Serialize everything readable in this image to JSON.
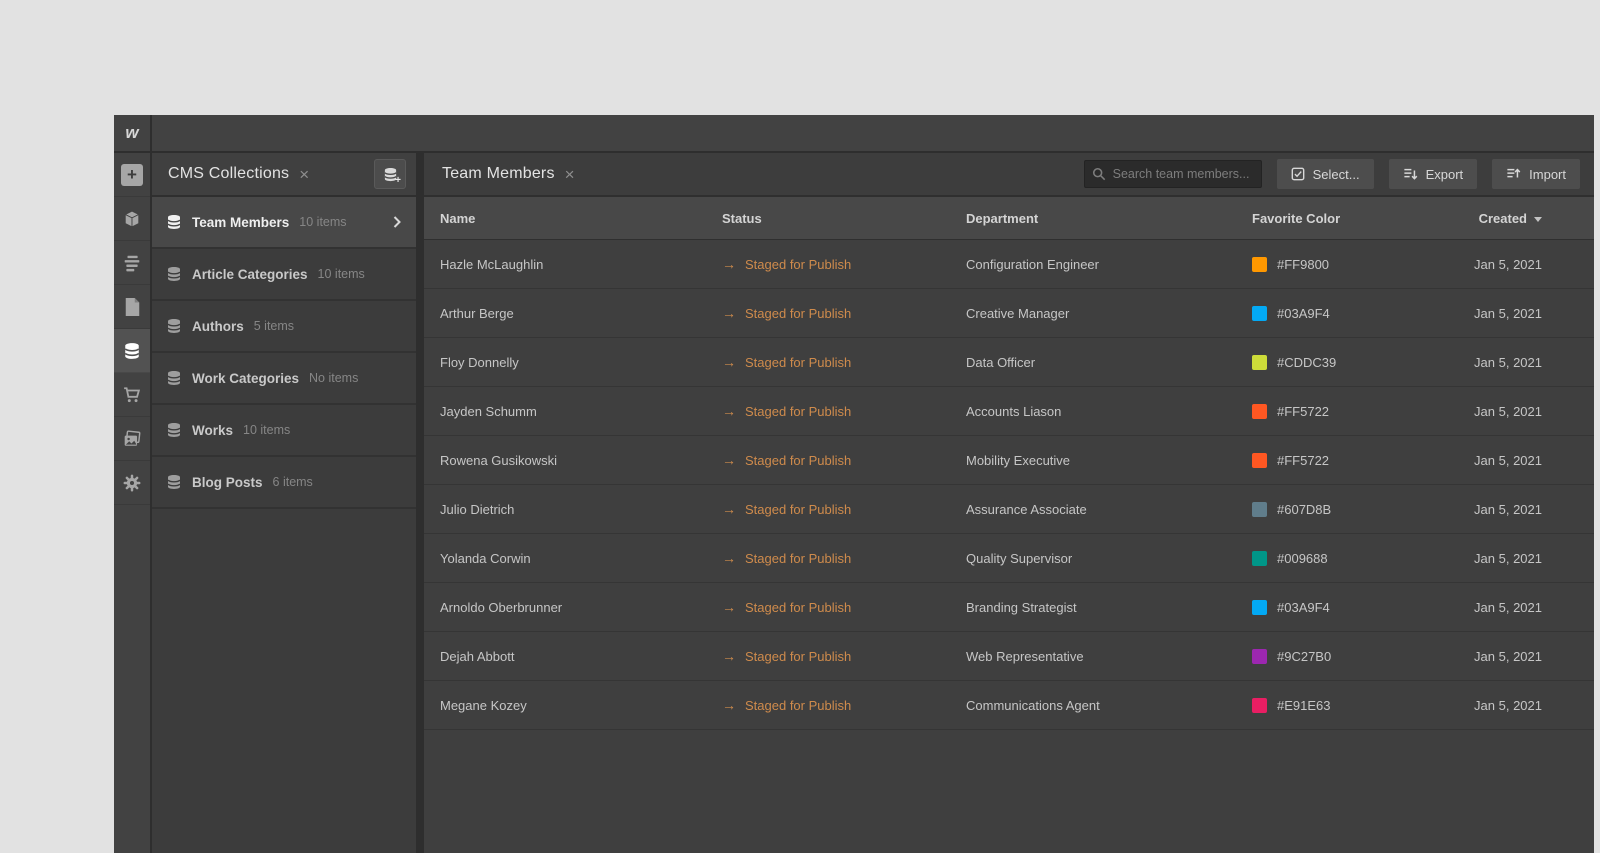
{
  "topbar": {
    "logo": "w"
  },
  "nav": {
    "items": [
      "add-panel",
      "components",
      "navigator",
      "pages",
      "cms",
      "ecommerce",
      "assets",
      "settings"
    ],
    "active": "cms"
  },
  "collections_panel": {
    "title": "CMS Collections",
    "close_glyph": "×",
    "items": [
      {
        "name": "Team Members",
        "count": "10 items",
        "selected": true
      },
      {
        "name": "Article Categories",
        "count": "10 items",
        "selected": false
      },
      {
        "name": "Authors",
        "count": "5 items",
        "selected": false
      },
      {
        "name": "Work Categories",
        "count": "No items",
        "selected": false
      },
      {
        "name": "Works",
        "count": "10 items",
        "selected": false
      },
      {
        "name": "Blog Posts",
        "count": "6 items",
        "selected": false
      }
    ]
  },
  "main": {
    "title": "Team Members",
    "close_glyph": "×",
    "search_placeholder": "Search team members...",
    "buttons": {
      "select": "Select...",
      "export": "Export",
      "import": "Import"
    },
    "table": {
      "columns": [
        "Name",
        "Status",
        "Department",
        "Favorite Color",
        "Created"
      ],
      "sorted_column": "Created",
      "sort_direction": "desc",
      "status_color": "#CF8B4C",
      "arrow_glyph": "→",
      "rows": [
        {
          "name": "Hazle McLaughlin",
          "status": "Staged for Publish",
          "department": "Configuration Engineer",
          "color": "#FF9800",
          "created": "Jan 5, 2021"
        },
        {
          "name": "Arthur Berge",
          "status": "Staged for Publish",
          "department": "Creative Manager",
          "color": "#03A9F4",
          "created": "Jan 5, 2021"
        },
        {
          "name": "Floy Donnelly",
          "status": "Staged for Publish",
          "department": "Data Officer",
          "color": "#CDDC39",
          "created": "Jan 5, 2021"
        },
        {
          "name": "Jayden Schumm",
          "status": "Staged for Publish",
          "department": "Accounts Liason",
          "color": "#FF5722",
          "created": "Jan 5, 2021"
        },
        {
          "name": "Rowena Gusikowski",
          "status": "Staged for Publish",
          "department": "Mobility Executive",
          "color": "#FF5722",
          "created": "Jan 5, 2021"
        },
        {
          "name": "Julio Dietrich",
          "status": "Staged for Publish",
          "department": "Assurance Associate",
          "color": "#607D8B",
          "created": "Jan 5, 2021"
        },
        {
          "name": "Yolanda Corwin",
          "status": "Staged for Publish",
          "department": "Quality Supervisor",
          "color": "#009688",
          "created": "Jan 5, 2021"
        },
        {
          "name": "Arnoldo Oberbrunner",
          "status": "Staged for Publish",
          "department": "Branding Strategist",
          "color": "#03A9F4",
          "created": "Jan 5, 2021"
        },
        {
          "name": "Dejah Abbott",
          "status": "Staged for Publish",
          "department": "Web Representative",
          "color": "#9C27B0",
          "created": "Jan 5, 2021"
        },
        {
          "name": "Megane Kozey",
          "status": "Staged for Publish",
          "department": "Communications Agent",
          "color": "#E91E63",
          "created": "Jan 5, 2021"
        }
      ]
    }
  }
}
